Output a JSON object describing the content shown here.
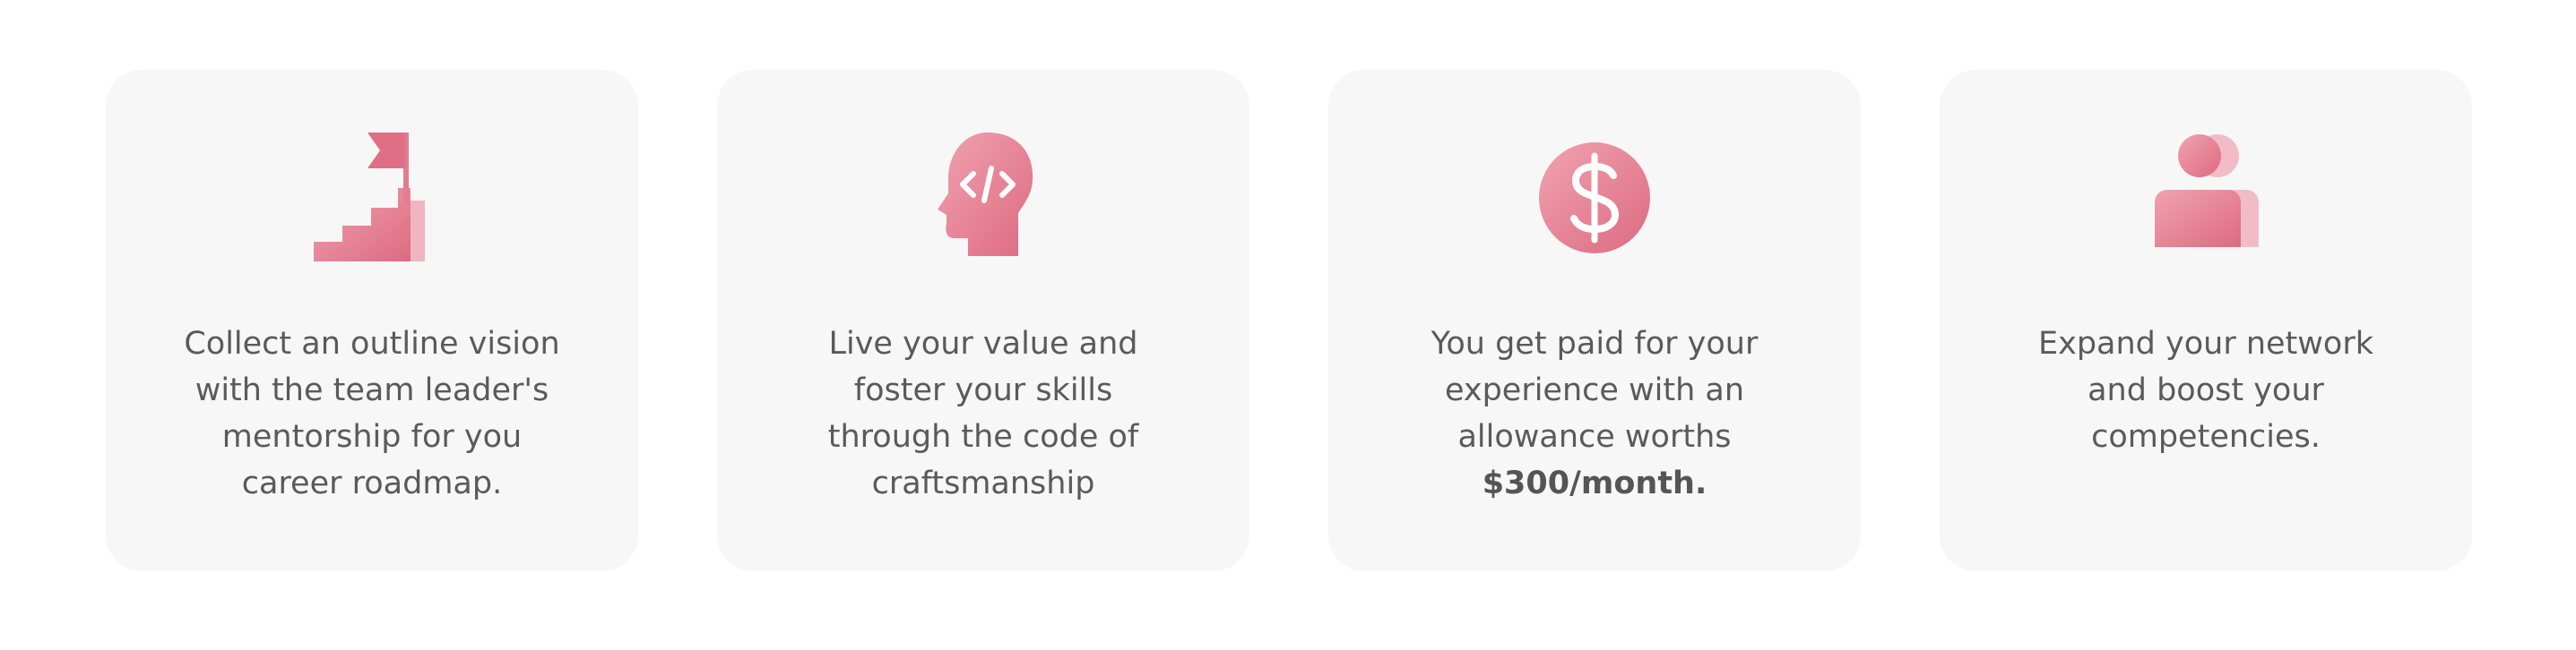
{
  "colors": {
    "card_bg": "#f7f7f7",
    "accent_light": "#f0a3b0",
    "accent_dark": "#dd6a80",
    "text": "#5a5a5a"
  },
  "cards": [
    {
      "icon": "stairs-flag-icon",
      "lines": [
        "Collect an outline vision",
        "with the team leader's",
        "mentorship for you",
        "career roadmap."
      ]
    },
    {
      "icon": "head-code-icon",
      "lines": [
        "Live your value and",
        "foster your skills",
        "through the code of",
        "craftsmanship"
      ]
    },
    {
      "icon": "dollar-coin-icon",
      "lines": [
        "You get paid for your",
        "experience with an",
        "allowance worths",
        "$300/month."
      ]
    },
    {
      "icon": "users-icon",
      "lines": [
        "Expand your network",
        "and boost your",
        "competencies."
      ]
    }
  ]
}
